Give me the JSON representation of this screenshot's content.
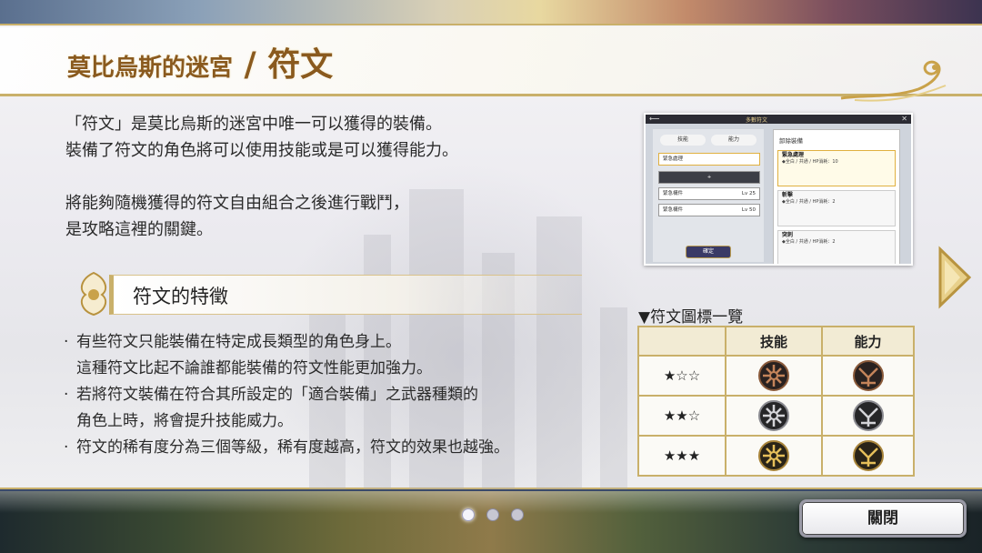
{
  "header": {
    "title_main": "莫比烏斯的迷宮",
    "title_sep": " / ",
    "title_sub": "符文"
  },
  "intro": {
    "lines": [
      "「符文」是莫比烏斯的迷宮中唯一可以獲得的裝備。",
      "裝備了符文的角色將可以使用技能或是可以獲得能力。",
      "將能夠隨機獲得的符文自由組合之後進行戰鬥，",
      "是攻略這裡的關鍵。"
    ]
  },
  "section": {
    "title": "符文的特徵",
    "features": [
      "有些符文只能裝備在特定成長類型的角色身上。",
      "這種符文比起不論誰都能裝備的符文性能更加強力。",
      "若將符文裝備在符合其所設定的「適合裝備」之武器種類的",
      "角色上時，將會提升技能威力。",
      "符文的稀有度分為三個等級，稀有度越高，符文的效果也越強。"
    ]
  },
  "preview": {
    "top_title": "多數符文",
    "tab_skill": "技能",
    "tab_ability": "能力",
    "items": [
      "緊急處理",
      "+",
      "緊急構件",
      "緊急構件"
    ],
    "levels": [
      "",
      "",
      "Lv 25",
      "Lv 50"
    ],
    "button": "確定",
    "right_header": "卸除裝備",
    "cards": [
      {
        "name": "緊急處理",
        "text": "◆全白 / 共通 / HP消耗：10"
      },
      {
        "name": "斬擊",
        "text": "◆全白 / 共通 / HP消耗：2"
      },
      {
        "name": "突刺",
        "text": "◆全白 / 共通 / HP消耗：2"
      }
    ]
  },
  "rune_table": {
    "title": "▼符文圖標一覽",
    "headers": [
      "",
      "技能",
      "能力"
    ],
    "rows": [
      {
        "stars": "★☆☆",
        "tier": "bronze"
      },
      {
        "stars": "★★☆",
        "tier": "silver"
      },
      {
        "stars": "★★★",
        "tier": "gold"
      }
    ]
  },
  "close_label": "關閉",
  "colors": {
    "gold_border": "#c9b06a",
    "title_brown": "#8a5a1e",
    "bronze": "#b0704a",
    "silver": "#c8c8c8",
    "gold": "#e0b040"
  }
}
